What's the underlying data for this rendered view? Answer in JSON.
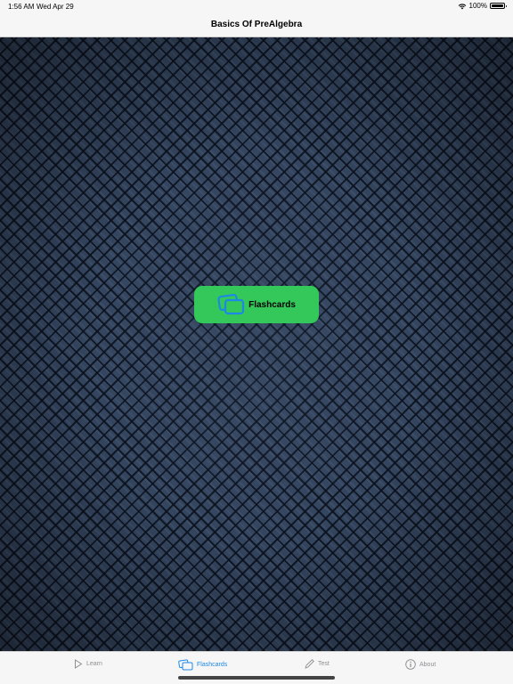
{
  "status_bar": {
    "time": "1:56 AM",
    "date": "Wed Apr 29",
    "battery_percent": "100%",
    "battery_level": 1.0
  },
  "nav": {
    "title": "Basics Of PreAlgebra"
  },
  "main": {
    "flashcards_button": {
      "label": "Flashcards",
      "icon": "flashcards-icon",
      "color": "#34c759"
    }
  },
  "tabs": [
    {
      "label": "Learn",
      "icon": "play-icon",
      "active": false
    },
    {
      "label": "Flashcards",
      "icon": "flashcards-icon",
      "active": true
    },
    {
      "label": "Test",
      "icon": "pencil-icon",
      "active": false
    },
    {
      "label": "About",
      "icon": "info-icon",
      "active": false
    }
  ],
  "colors": {
    "accent": "#1e88e5",
    "inactive_tab": "#8e8e93",
    "background": "#34455f"
  }
}
